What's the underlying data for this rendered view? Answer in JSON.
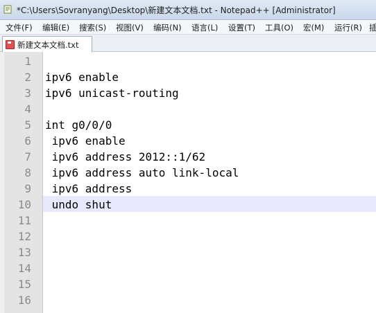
{
  "window": {
    "title": "*C:\\Users\\Sovranyang\\Desktop\\新建文本文档.txt - Notepad++ [Administrator]"
  },
  "menu": {
    "items": [
      {
        "label": "文件(F)"
      },
      {
        "label": "编辑(E)"
      },
      {
        "label": "搜索(S)"
      },
      {
        "label": "视图(V)"
      },
      {
        "label": "编码(N)"
      },
      {
        "label": "语言(L)"
      },
      {
        "label": "设置(T)"
      },
      {
        "label": "工具(O)"
      },
      {
        "label": "宏(M)"
      },
      {
        "label": "运行(R)"
      },
      {
        "label": "插"
      }
    ]
  },
  "tabs": [
    {
      "label": "新建文本文档.txt",
      "modified": true
    }
  ],
  "editor": {
    "current_line": 10,
    "lines": [
      {
        "num": "1",
        "text": ""
      },
      {
        "num": "2",
        "text": "ipv6 enable"
      },
      {
        "num": "3",
        "text": "ipv6 unicast-routing"
      },
      {
        "num": "4",
        "text": ""
      },
      {
        "num": "5",
        "text": "int g0/0/0"
      },
      {
        "num": "6",
        "text": " ipv6 enable"
      },
      {
        "num": "7",
        "text": " ipv6 address 2012::1/62"
      },
      {
        "num": "8",
        "text": " ipv6 address auto link-local"
      },
      {
        "num": "9",
        "text": " ipv6 address"
      },
      {
        "num": "10",
        "text": " undo shut"
      },
      {
        "num": "11",
        "text": ""
      },
      {
        "num": "12",
        "text": ""
      },
      {
        "num": "13",
        "text": ""
      },
      {
        "num": "14",
        "text": ""
      },
      {
        "num": "15",
        "text": ""
      },
      {
        "num": "16",
        "text": ""
      }
    ]
  },
  "colors": {
    "current_line_highlight": "#e8e8ff",
    "line_number_bg": "#e4e4e4",
    "line_number_fg": "#8a8a8a",
    "tab_modified_icon": "#e05050"
  },
  "icons": {
    "app": "notepadpp-icon",
    "tab": "unsaved-file-icon"
  }
}
